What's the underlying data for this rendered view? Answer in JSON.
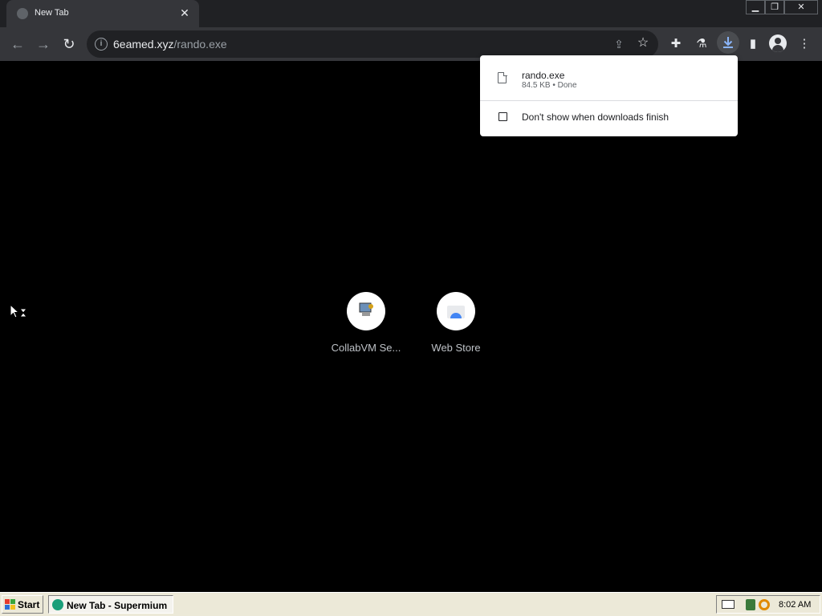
{
  "tab": {
    "title": "New Tab",
    "close_glyph": "✕"
  },
  "window_controls": {
    "minimize": "▁",
    "restore": "❐",
    "close": "✕"
  },
  "toolbar": {
    "back": "←",
    "forward": "→",
    "reload": "↻",
    "url_host": "6eamed.xyz",
    "url_path": "/rando.exe",
    "share_glyph": "⇪",
    "star_glyph": "☆",
    "extensions_glyph": "✚",
    "labs_glyph": "⚗",
    "sidepanel_glyph": "▮",
    "menu_glyph": "⋮"
  },
  "download_bubble": {
    "file_name": "rando.exe",
    "file_meta": "84.5 KB • Done",
    "checkbox_label": "Don't show when downloads finish",
    "checked": false
  },
  "shortcuts": [
    {
      "label": "CollabVM Se..."
    },
    {
      "label": "Web Store"
    }
  ],
  "taskbar": {
    "start_label": "Start",
    "task_label": "New Tab - Supermium",
    "clock": "8:02 AM"
  },
  "colors": {
    "tabstrip": "#202124",
    "toolbar": "#35363a",
    "download_accent": "#8ab4f8",
    "taskbar": "#ece9d8"
  }
}
